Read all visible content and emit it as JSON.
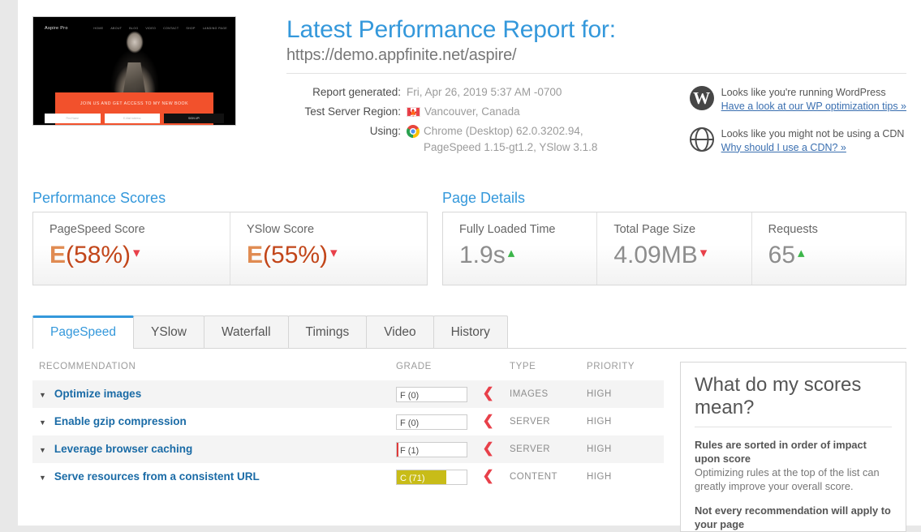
{
  "thumbnail": {
    "logo": "Aspire Pro",
    "nav": [
      "HOME",
      "ABOUT",
      "BLOG",
      "VIDEO",
      "CONTACT",
      "SHOP",
      "LANDING PAGE"
    ],
    "cta": "JOIN US AND GET ACCESS TO MY NEW BOOK",
    "field_first": "First Name",
    "field_email": "E-Mail Address",
    "field_button": "SIGN UP!"
  },
  "header": {
    "title": "Latest Performance Report for:",
    "url": "https://demo.appfinite.net/aspire/",
    "meta": [
      {
        "label": "Report generated:",
        "value": "Fri, Apr 26, 2019 5:37 AM -0700",
        "icon": ""
      },
      {
        "label": "Test Server Region:",
        "value": "Vancouver, Canada",
        "icon": "canada-flag-icon"
      },
      {
        "label": "Using:",
        "value": "Chrome (Desktop) 62.0.3202.94,",
        "value2": "PageSpeed 1.15-gt1.2, YSlow 3.1.8",
        "icon": "chrome-icon"
      }
    ],
    "notices": [
      {
        "icon": "wordpress-icon",
        "text": "Looks like you're running WordPress",
        "link": "Have a look at our WP optimization tips »"
      },
      {
        "icon": "globe-icon",
        "text": "Looks like you might not be using a CDN",
        "link": "Why should I use a CDN? »"
      }
    ]
  },
  "performance_scores": {
    "heading": "Performance Scores",
    "cards": [
      {
        "label": "PageSpeed Score",
        "grade": "E",
        "value": "(58%)",
        "caret": "down"
      },
      {
        "label": "YSlow Score",
        "grade": "E",
        "value": "(55%)",
        "caret": "down"
      }
    ]
  },
  "page_details": {
    "heading": "Page Details",
    "cards": [
      {
        "label": "Fully Loaded Time",
        "value": "1.9s",
        "caret": "up"
      },
      {
        "label": "Total Page Size",
        "value": "4.09MB",
        "caret": "down"
      },
      {
        "label": "Requests",
        "value": "65",
        "caret": "up"
      }
    ]
  },
  "tabs": [
    {
      "label": "PageSpeed",
      "active": true
    },
    {
      "label": "YSlow",
      "active": false
    },
    {
      "label": "Waterfall",
      "active": false
    },
    {
      "label": "Timings",
      "active": false
    },
    {
      "label": "Video",
      "active": false
    },
    {
      "label": "History",
      "active": false
    }
  ],
  "table": {
    "columns": [
      "RECOMMENDATION",
      "GRADE",
      "TYPE",
      "PRIORITY"
    ],
    "rows": [
      {
        "name": "Optimize images",
        "grade": "F (0)",
        "fill_pct": 0,
        "fill_color": "#ffffff",
        "text_color": "#4d4d4d",
        "type": "IMAGES",
        "priority": "HIGH"
      },
      {
        "name": "Enable gzip compression",
        "grade": "F (0)",
        "fill_pct": 0,
        "fill_color": "#ffffff",
        "text_color": "#4d4d4d",
        "type": "SERVER",
        "priority": "HIGH"
      },
      {
        "name": "Leverage browser caching",
        "grade": "F (1)",
        "fill_pct": 2,
        "fill_color": "#e03a3a",
        "text_color": "#4d4d4d",
        "type": "SERVER",
        "priority": "HIGH"
      },
      {
        "name": "Serve resources from a consistent URL",
        "grade": "C (71)",
        "fill_pct": 71,
        "fill_color": "#c8bc18",
        "text_color": "#ffffff",
        "type": "CONTENT",
        "priority": "HIGH"
      }
    ]
  },
  "sidebar": {
    "heading": "What do my scores mean?",
    "items": [
      {
        "bold": "Rules are sorted in order of impact upon score",
        "text": "Optimizing rules at the top of the list can greatly improve your overall score."
      },
      {
        "bold": "Not every recommendation will apply to your page",
        "text": ""
      }
    ]
  },
  "colors": {
    "accent": "#3498db",
    "grade_letter": "#e08b52",
    "grade_pct": "#c2461a",
    "down": "#e8404a",
    "up": "#3cb54a"
  }
}
